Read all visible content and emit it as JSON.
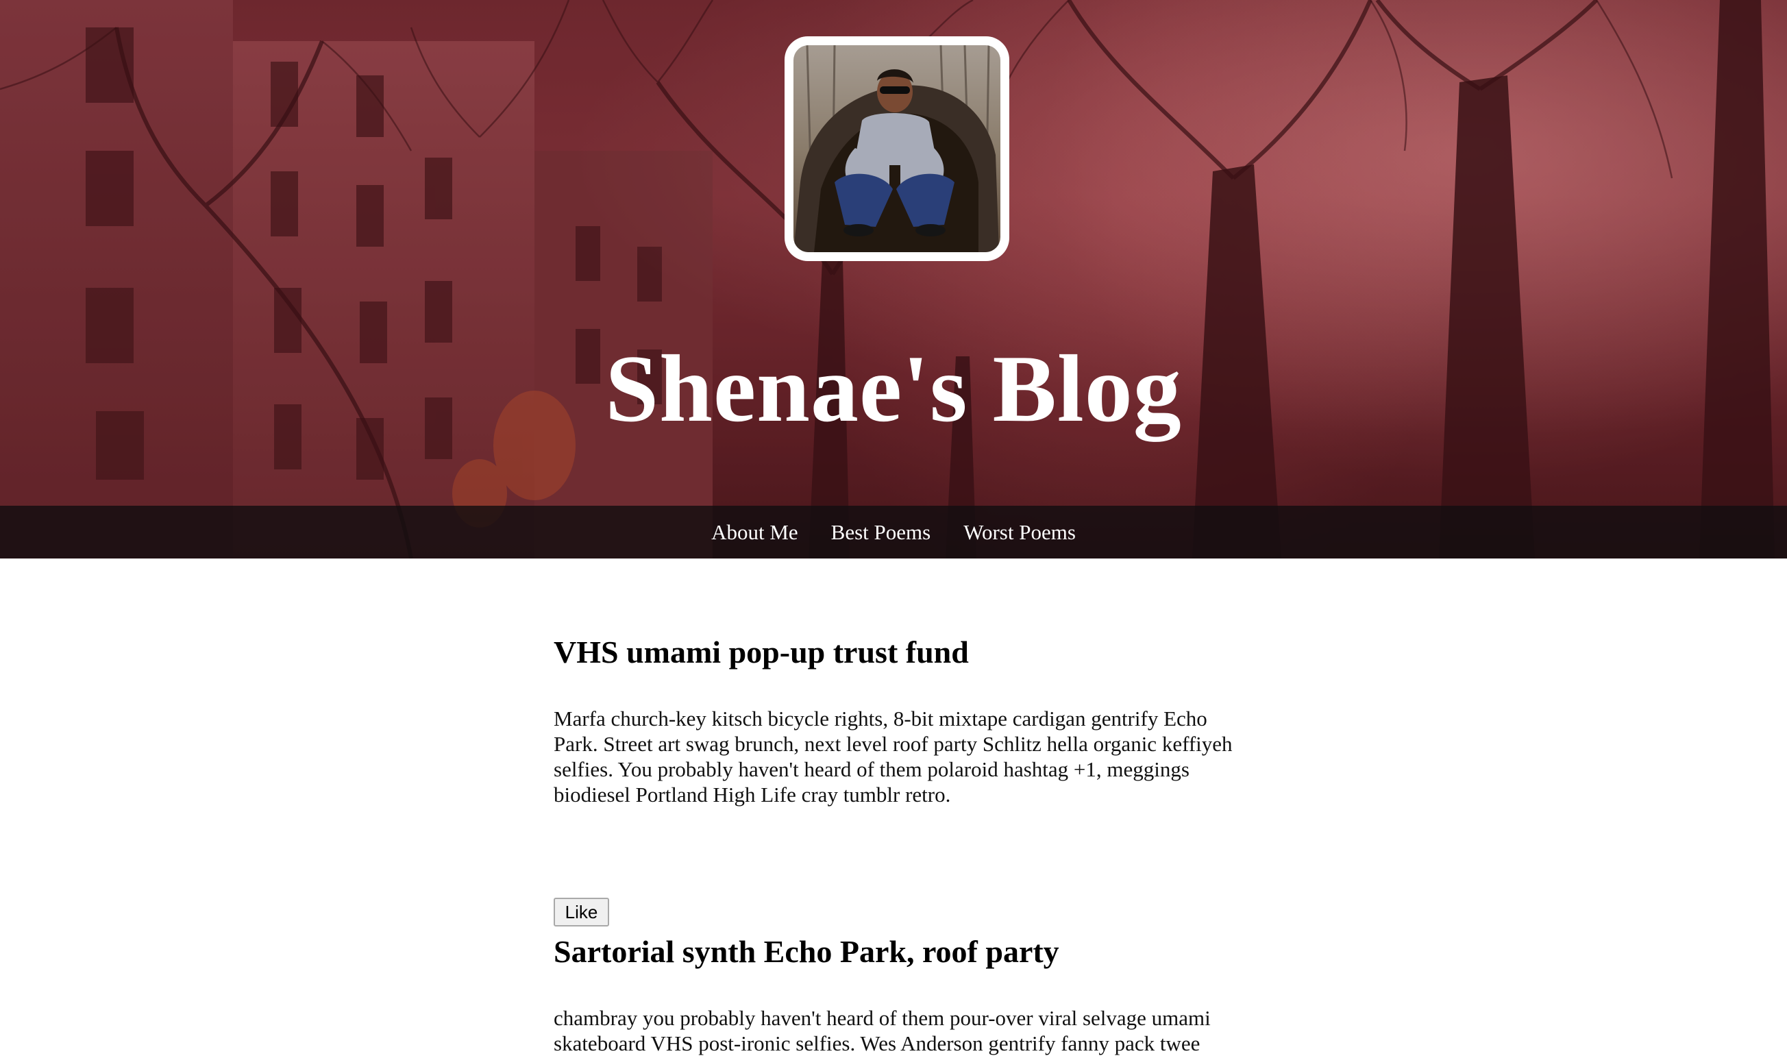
{
  "site": {
    "title": "Shenae's Blog"
  },
  "nav": {
    "items": [
      {
        "label": "About Me"
      },
      {
        "label": "Best Poems"
      },
      {
        "label": "Worst Poems"
      }
    ]
  },
  "posts": [
    {
      "title": "VHS umami pop-up trust fund",
      "body": "Marfa church-key kitsch bicycle rights, 8-bit mixtape cardigan gentrify Echo Park. Street art swag brunch, next level roof party Schlitz hella organic keffiyeh selfies. You probably haven't heard of them polaroid hashtag +1, meggings biodiesel Portland High Life cray tumblr retro.",
      "like_label": "Like"
    },
    {
      "title": "Sartorial synth Echo Park, roof party",
      "body": "chambray you probably haven't heard of them pour-over viral selvage umami skateboard VHS post-ironic selfies. Wes Anderson gentrify fanny pack twee"
    }
  ],
  "colors": {
    "hero_tint": "#6b2a30",
    "nav_background": "#120e10",
    "nav_text": "#ffffff",
    "title_text": "#ffffff"
  }
}
